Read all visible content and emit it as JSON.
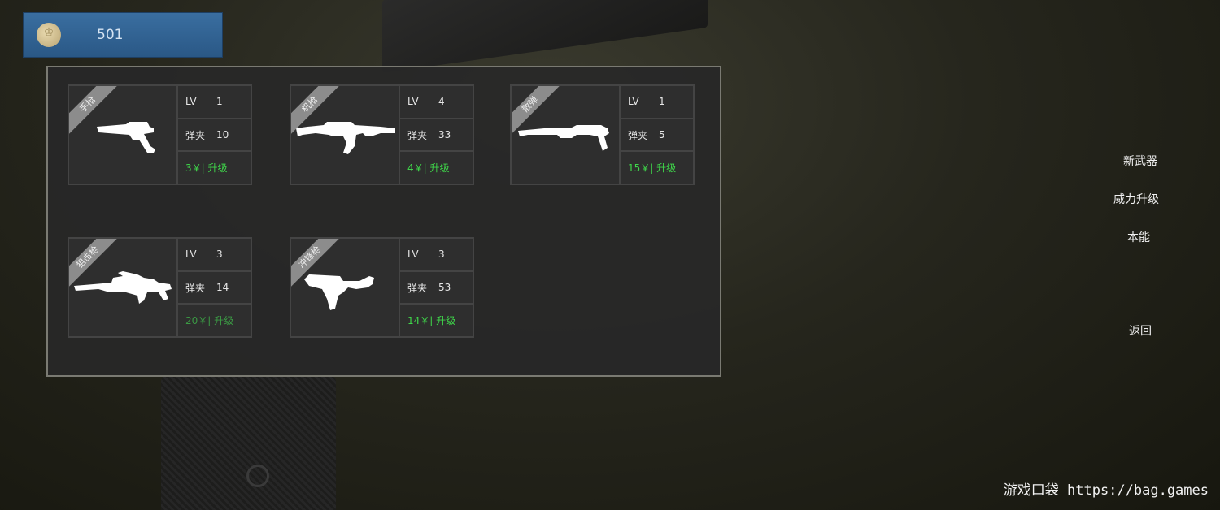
{
  "currency": {
    "value": "501",
    "icon": "crown-coin-icon"
  },
  "weapons": [
    {
      "category": "手枪",
      "icon": "revolver-icon",
      "lv_label": "LV",
      "lv": "1",
      "mag_label": "弹夹",
      "mag": "10",
      "upgrade": "3￥| 升级"
    },
    {
      "category": "机枪",
      "icon": "assault-rifle-icon",
      "lv_label": "LV",
      "lv": "4",
      "mag_label": "弹夹",
      "mag": "33",
      "upgrade": "4￥| 升级"
    },
    {
      "category": "散弹",
      "icon": "shotgun-icon",
      "lv_label": "LV",
      "lv": "1",
      "mag_label": "弹夹",
      "mag": "5",
      "upgrade": "15￥| 升级"
    },
    {
      "category": "狙击枪",
      "icon": "sniper-rifle-icon",
      "lv_label": "LV",
      "lv": "3",
      "mag_label": "弹夹",
      "mag": "14",
      "upgrade": "20￥| 升级"
    },
    {
      "category": "冲锋枪",
      "icon": "smg-icon",
      "lv_label": "LV",
      "lv": "3",
      "mag_label": "弹夹",
      "mag": "53",
      "upgrade": "14￥| 升级"
    }
  ],
  "menu": {
    "new_weapon": "新武器",
    "power_upgrade": "威力升级",
    "ability": "本能",
    "back": "返回"
  },
  "watermark": {
    "name": "游戏口袋",
    "url": "https://bag.games"
  },
  "colors": {
    "upgrade_text": "#3fd64a",
    "coin_bar": "#2f6393"
  }
}
